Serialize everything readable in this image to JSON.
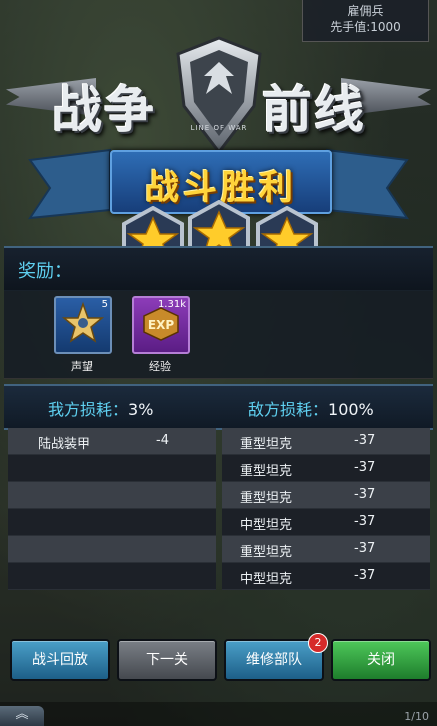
{
  "mercenary": {
    "title": "雇佣兵",
    "initiative": "先手值:1000"
  },
  "logo": {
    "left": "战争",
    "right": "前线",
    "subtitle": "LINE OF WAR"
  },
  "banner": {
    "title": "战斗胜利"
  },
  "stars": {
    "earned": 3,
    "total": 3
  },
  "rewards": {
    "label": "奖励：",
    "items": [
      {
        "name": "声望",
        "count": "5",
        "icon": "prestige-medal-icon"
      },
      {
        "name": "经验",
        "count": "1.31k",
        "icon": "exp-badge-icon"
      }
    ]
  },
  "losses": {
    "mine": {
      "label": "我方损耗：",
      "value": "3%"
    },
    "enemy": {
      "label": "敌方损耗：",
      "value": "100%"
    }
  },
  "my_units": [
    {
      "name": "陆战装甲",
      "change": "-4"
    },
    {
      "name": "",
      "change": ""
    },
    {
      "name": "",
      "change": ""
    },
    {
      "name": "",
      "change": ""
    },
    {
      "name": "",
      "change": ""
    },
    {
      "name": "",
      "change": ""
    }
  ],
  "enemy_units": [
    {
      "name": "重型坦克",
      "change": "-37"
    },
    {
      "name": "重型坦克",
      "change": "-37"
    },
    {
      "name": "重型坦克",
      "change": "-37"
    },
    {
      "name": "中型坦克",
      "change": "-37"
    },
    {
      "name": "重型坦克",
      "change": "-37"
    },
    {
      "name": "中型坦克",
      "change": "-37"
    }
  ],
  "buttons": {
    "replay": "战斗回放",
    "next": "下一关",
    "repair": "维修部队",
    "repair_badge": "2",
    "close": "关闭"
  },
  "bottom": {
    "pager": "1/10"
  },
  "colors": {
    "accent": "#5fd0f0",
    "gold": "#ffd43a",
    "close_green": "#2fa03c"
  }
}
